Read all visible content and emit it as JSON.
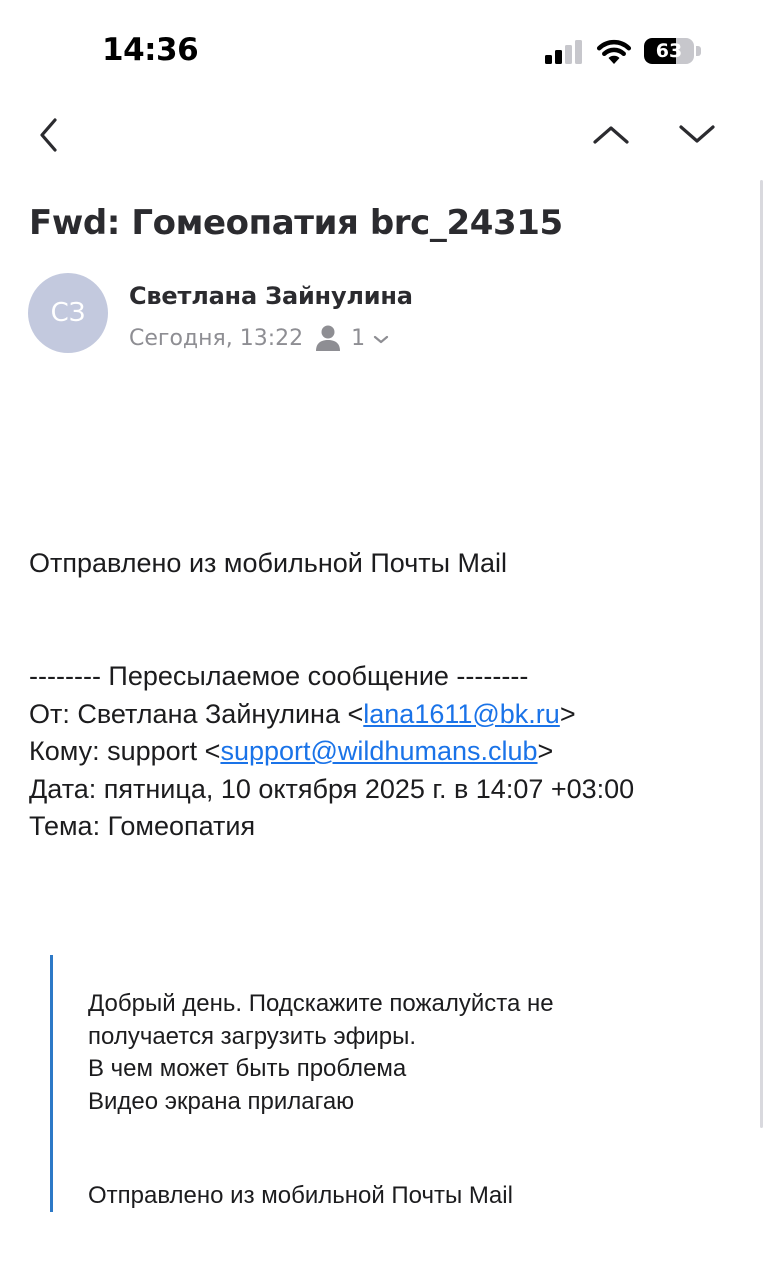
{
  "status_bar": {
    "time": "14:36",
    "battery_level": "63",
    "battery_fraction": 0.63,
    "icons": [
      "signal-icon",
      "wifi-icon",
      "battery-icon"
    ]
  },
  "nav": {
    "back_icon": "chevron-left-icon",
    "prev_icon": "chevron-up-icon",
    "next_icon": "chevron-down-icon"
  },
  "email": {
    "subject": "Fwd: Гомеопатия brc_24315",
    "sender": {
      "initials": "СЗ",
      "name": "Светлана Зайнулина",
      "date": "Сегодня, 13:22",
      "recipients_count": "1"
    },
    "body": {
      "signature": "Отправлено из мобильной Почты Mail",
      "forward_header": "-------- Пересылаемое сообщение --------",
      "from_label": "От: Светлана Зайнулина <",
      "from_email": "lana1611@bk.ru",
      "from_close": ">",
      "to_label": "Кому: support <",
      "to_email": "support@wildhumans.club",
      "to_close": ">",
      "date_line": "Дата: пятница, 10 октября 2025 г. в 14:07 +03:00",
      "subject_line": "Тема: Гомеопатия"
    },
    "quoted": {
      "lines": [
        "Добрый день. Подскажите пожалуйста не",
        "получается загрузить эфиры.",
        "В чем может быть проблема",
        "Видео экрана прилагаю"
      ],
      "signature": "Отправлено из мобильной Почты Mail"
    }
  },
  "colors": {
    "link": "#1a73e8",
    "quote_bar": "#2d79c7",
    "avatar_bg": "#c3c9de",
    "meta_gray": "#8e8e93"
  }
}
